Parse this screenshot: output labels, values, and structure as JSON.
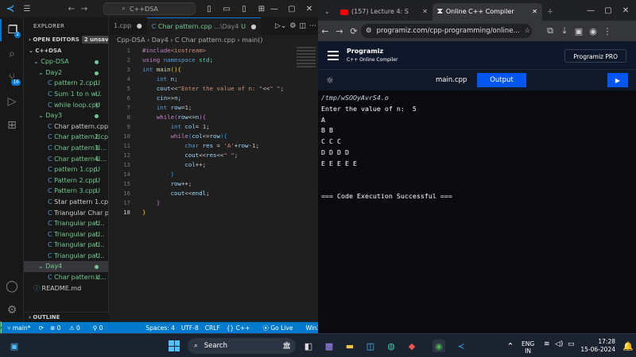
{
  "vscode": {
    "search": "C++DSA",
    "activity_badges": {
      "accounts": "2",
      "source_control": "16"
    },
    "explorer": {
      "header": "EXPLORER",
      "open_editors": "OPEN EDITORS",
      "unsaved": "2 unsaved",
      "root": "C++DSA",
      "project": "Cpp-DSA",
      "folder_day2": "Day2",
      "day2_files": [
        {
          "name": "pattern 2.cpp",
          "status": "U"
        },
        {
          "name": "Sum 1 to n w...",
          "status": "U"
        },
        {
          "name": "while loop.cpp",
          "status": "U"
        }
      ],
      "folder_day3": "Day3",
      "day3_files": [
        {
          "name": "Char pattern.cpp",
          "status": ""
        },
        {
          "name": "Char pattern2.cpp",
          "status": "U"
        },
        {
          "name": "Char pattern3....",
          "status": "U"
        },
        {
          "name": "Char pattern4....",
          "status": "U"
        },
        {
          "name": "pattern 1.cpp",
          "status": "U"
        },
        {
          "name": "Pattern 2.cpp",
          "status": "U"
        },
        {
          "name": "Pattern 3.cpp",
          "status": "U"
        },
        {
          "name": "Star pattern 1.cpp",
          "status": ""
        },
        {
          "name": "Triangular Char pat...",
          "status": ""
        },
        {
          "name": "Triangular pat...",
          "status": "U"
        },
        {
          "name": "Triangular pat...",
          "status": "U"
        },
        {
          "name": "Triangular pat...",
          "status": "U"
        },
        {
          "name": "Triangular pat...",
          "status": "U"
        }
      ],
      "folder_day4": "Day4",
      "day4_files": [
        {
          "name": "Char pattern.c...",
          "status": "U"
        }
      ],
      "readme": "README.md",
      "outline": "OUTLINE"
    },
    "tabs": [
      {
        "label": "1.cpp",
        "mark": "●"
      },
      {
        "label": "Char pattern.cpp",
        "hint": "...\\Day4",
        "status": "U",
        "mark": "●"
      }
    ],
    "breadcrumb": "Cpp-DSA › Day4 › C Char pattern.cpp › main()",
    "line_numbers": [
      "1",
      "2",
      "3",
      "4",
      "5",
      "6",
      "7",
      "8",
      "9",
      "10",
      "11",
      "12",
      "13",
      "14",
      "15",
      "16",
      "17",
      "18"
    ],
    "statusbar": {
      "branch": "main*",
      "errors": "0",
      "warnings": "0",
      "ports": "0",
      "spaces": "Spaces: 4",
      "encoding": "UTF-8",
      "eol": "CRLF",
      "lang": "C++",
      "golive": "Go Live",
      "platform": "Win32"
    }
  },
  "browser": {
    "tabs": [
      {
        "label": "(157) Lecture 4: S"
      },
      {
        "label": "Online C++ Compiler"
      }
    ],
    "url": "programiz.com/cpp-programming/online...",
    "site": {
      "brand": "Programiz",
      "subtitle": "C++ Online Compiler",
      "pro_button": "Programiz PRO",
      "filename": "main.cpp",
      "output_button": "Output",
      "run_button": "▶"
    },
    "console": [
      "/tmp/wSOOyAvrS4.o",
      "Enter the value of n:  5",
      "A",
      "B B",
      "C C C",
      "D D D D",
      "E E E E E",
      "",
      "",
      "=== Code Execution Successful ==="
    ]
  },
  "taskbar": {
    "search": "Search",
    "lang1": "ENG",
    "lang2": "IN",
    "time": "17:28",
    "date": "15-06-2024"
  },
  "colors": {
    "accent": "#007acc",
    "run": "#0556f3"
  }
}
